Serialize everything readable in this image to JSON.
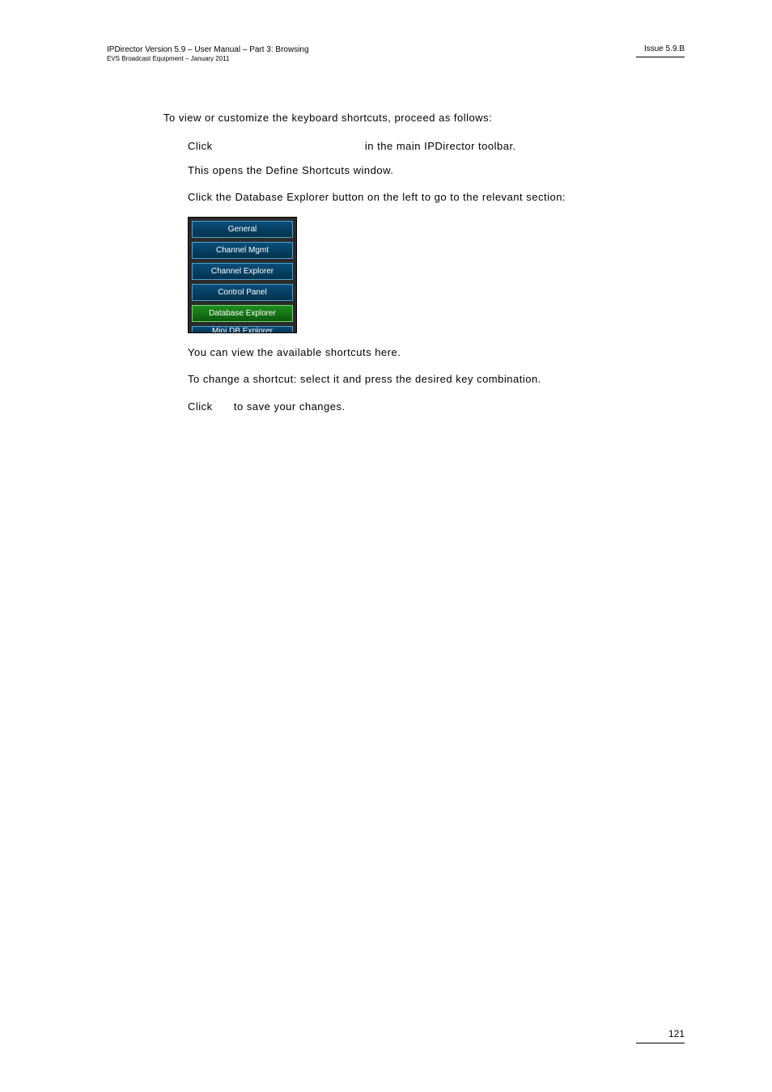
{
  "header": {
    "left_line1": "IPDirector Version 5.9 – User Manual – Part 3: Browsing",
    "left_line2": "EVS Broadcast Equipment – January 2011",
    "right": "Issue 5.9.B"
  },
  "content": {
    "intro": "To view or customize the keyboard shortcuts, proceed as follows:",
    "step1_a": "Click",
    "step1_b": "in the main IPDirector toolbar.",
    "step1_note": "This opens the Define Shortcuts window.",
    "step2": "Click the Database Explorer button on the left to go to the relevant section:",
    "panel": {
      "items": [
        {
          "label": "General",
          "selected": false
        },
        {
          "label": "Channel Mgmt",
          "selected": false
        },
        {
          "label": "Channel Explorer",
          "selected": false
        },
        {
          "label": "Control Panel",
          "selected": false
        },
        {
          "label": "Database Explorer",
          "selected": true
        },
        {
          "label": "Mini DB Explorer",
          "selected": false,
          "cut": true
        }
      ]
    },
    "step3": "You can view the available shortcuts here.",
    "step4": "To change a shortcut: select it and press the desired key combination.",
    "step5_a": "Click",
    "step5_b": "to save your changes."
  },
  "footer": {
    "page_number": "121"
  }
}
